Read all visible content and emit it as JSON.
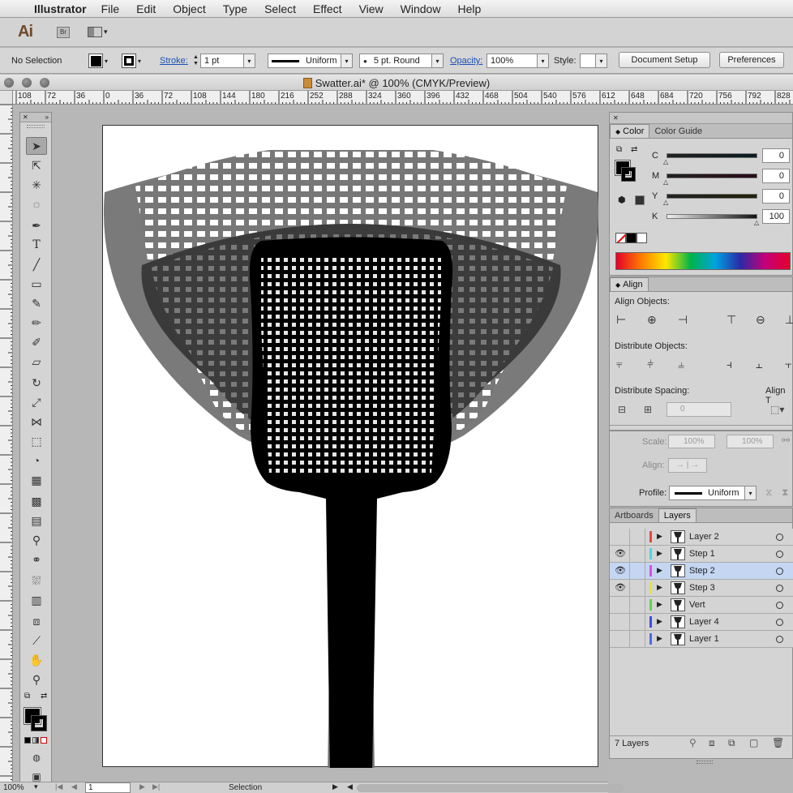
{
  "menubar": {
    "app_name": "Illustrator",
    "items": [
      "File",
      "Edit",
      "Object",
      "Type",
      "Select",
      "Effect",
      "View",
      "Window",
      "Help"
    ]
  },
  "appbar": {
    "logo": "Ai",
    "bridge": "Br"
  },
  "control": {
    "selection": "No Selection",
    "stroke_label": "Stroke:",
    "stroke_weight": "1 pt",
    "profile": "Uniform",
    "brush": "5 pt. Round",
    "opacity_label": "Opacity:",
    "opacity": "100%",
    "style_label": "Style:",
    "document_setup": "Document Setup",
    "preferences": "Preferences"
  },
  "document": {
    "title": "Swatter.ai* @ 100% (CMYK/Preview)"
  },
  "ruler": {
    "ticks": [
      "108",
      "72",
      "36",
      "0",
      "36",
      "72",
      "108",
      "144",
      "180",
      "216",
      "252",
      "288",
      "324",
      "360",
      "396",
      "432",
      "468",
      "504",
      "540",
      "576",
      "612",
      "648",
      "684",
      "720",
      "756",
      "792",
      "828"
    ]
  },
  "color_panel": {
    "tabs": [
      "Color",
      "Color Guide"
    ],
    "channels": [
      {
        "label": "C",
        "value": "0"
      },
      {
        "label": "M",
        "value": "0"
      },
      {
        "label": "Y",
        "value": "0"
      },
      {
        "label": "K",
        "value": "100"
      }
    ]
  },
  "align_panel": {
    "title": "Align",
    "align_objects": "Align Objects:",
    "distribute_objects": "Distribute Objects:",
    "distribute_spacing": "Distribute Spacing:",
    "align_to": "Align T",
    "spacing_value": "0"
  },
  "stroke_options": {
    "scale_label": "Scale:",
    "scale1": "100%",
    "scale2": "100%",
    "align_label": "Align:",
    "profile_label": "Profile:",
    "profile_value": "Uniform"
  },
  "layers_panel": {
    "tabs": [
      "Artboards",
      "Layers"
    ],
    "layers": [
      {
        "name": "Layer 2",
        "visible": false,
        "color": "#e8453c",
        "selected": false
      },
      {
        "name": "Step 1",
        "visible": true,
        "color": "#49d6e6",
        "selected": false
      },
      {
        "name": "Step 2",
        "visible": true,
        "color": "#e24ce0",
        "selected": true
      },
      {
        "name": "Step 3",
        "visible": true,
        "color": "#e8e23c",
        "selected": false
      },
      {
        "name": "Vert",
        "visible": false,
        "color": "#5ad64a",
        "selected": false
      },
      {
        "name": "Layer 4",
        "visible": false,
        "color": "#3c4ae8",
        "selected": false
      },
      {
        "name": "Layer 1",
        "visible": false,
        "color": "#4a6ae8",
        "selected": false
      }
    ],
    "count": "7 Layers"
  },
  "statusbar": {
    "zoom": "100%",
    "artboard": "1",
    "tool": "Selection"
  }
}
